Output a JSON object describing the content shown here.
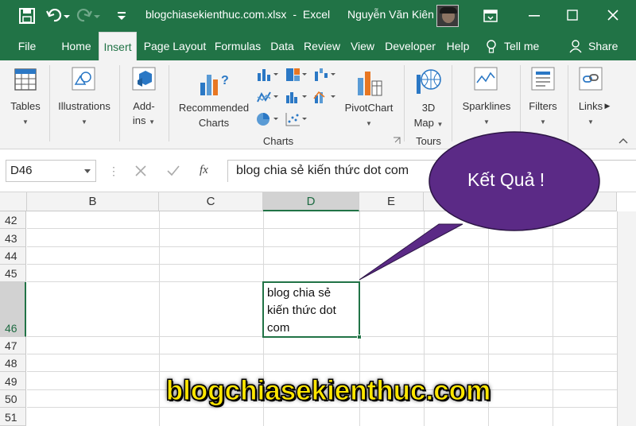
{
  "window": {
    "filename": "blogchiasekienthuc.com.xlsx",
    "separator": "-",
    "app_name": "Excel",
    "user_name": "Nguyễn Văn Kiên"
  },
  "tabs": [
    "File",
    "Home",
    "Insert",
    "Page Layout",
    "Formulas",
    "Data",
    "Review",
    "View",
    "Developer",
    "Help"
  ],
  "tell_me": "Tell me",
  "share": "Share",
  "ribbon": {
    "tables": "Tables",
    "illustrations": "Illustrations",
    "addins_1": "Add-",
    "addins_2": "ins",
    "recommended_1": "Recommended",
    "recommended_2": "Charts",
    "pivotchart": "PivotChart",
    "map_1": "3D",
    "map_2": "Map",
    "sparklines": "Sparklines",
    "filters": "Filters",
    "links": "Links",
    "group_charts": "Charts",
    "group_tours": "Tours"
  },
  "formula_bar": {
    "name_box": "D46",
    "fx": "fx",
    "content": "blog chia sẻ kiến thức dot com"
  },
  "grid": {
    "columns": [
      "B",
      "C",
      "D",
      "E"
    ],
    "rows": [
      "42",
      "43",
      "44",
      "45",
      "46",
      "47",
      "48",
      "49",
      "50",
      "51"
    ],
    "cell_d46_line1": "blog chia sẻ",
    "cell_d46_line2": "kiến thức dot",
    "cell_d46_line3": "com"
  },
  "callout": "Kết Quả !",
  "watermark": "blogchiasekienthuc.com",
  "colors": {
    "excel_green": "#217346",
    "callout_purple": "#5b2a86",
    "watermark_yellow": "#ffe600"
  }
}
